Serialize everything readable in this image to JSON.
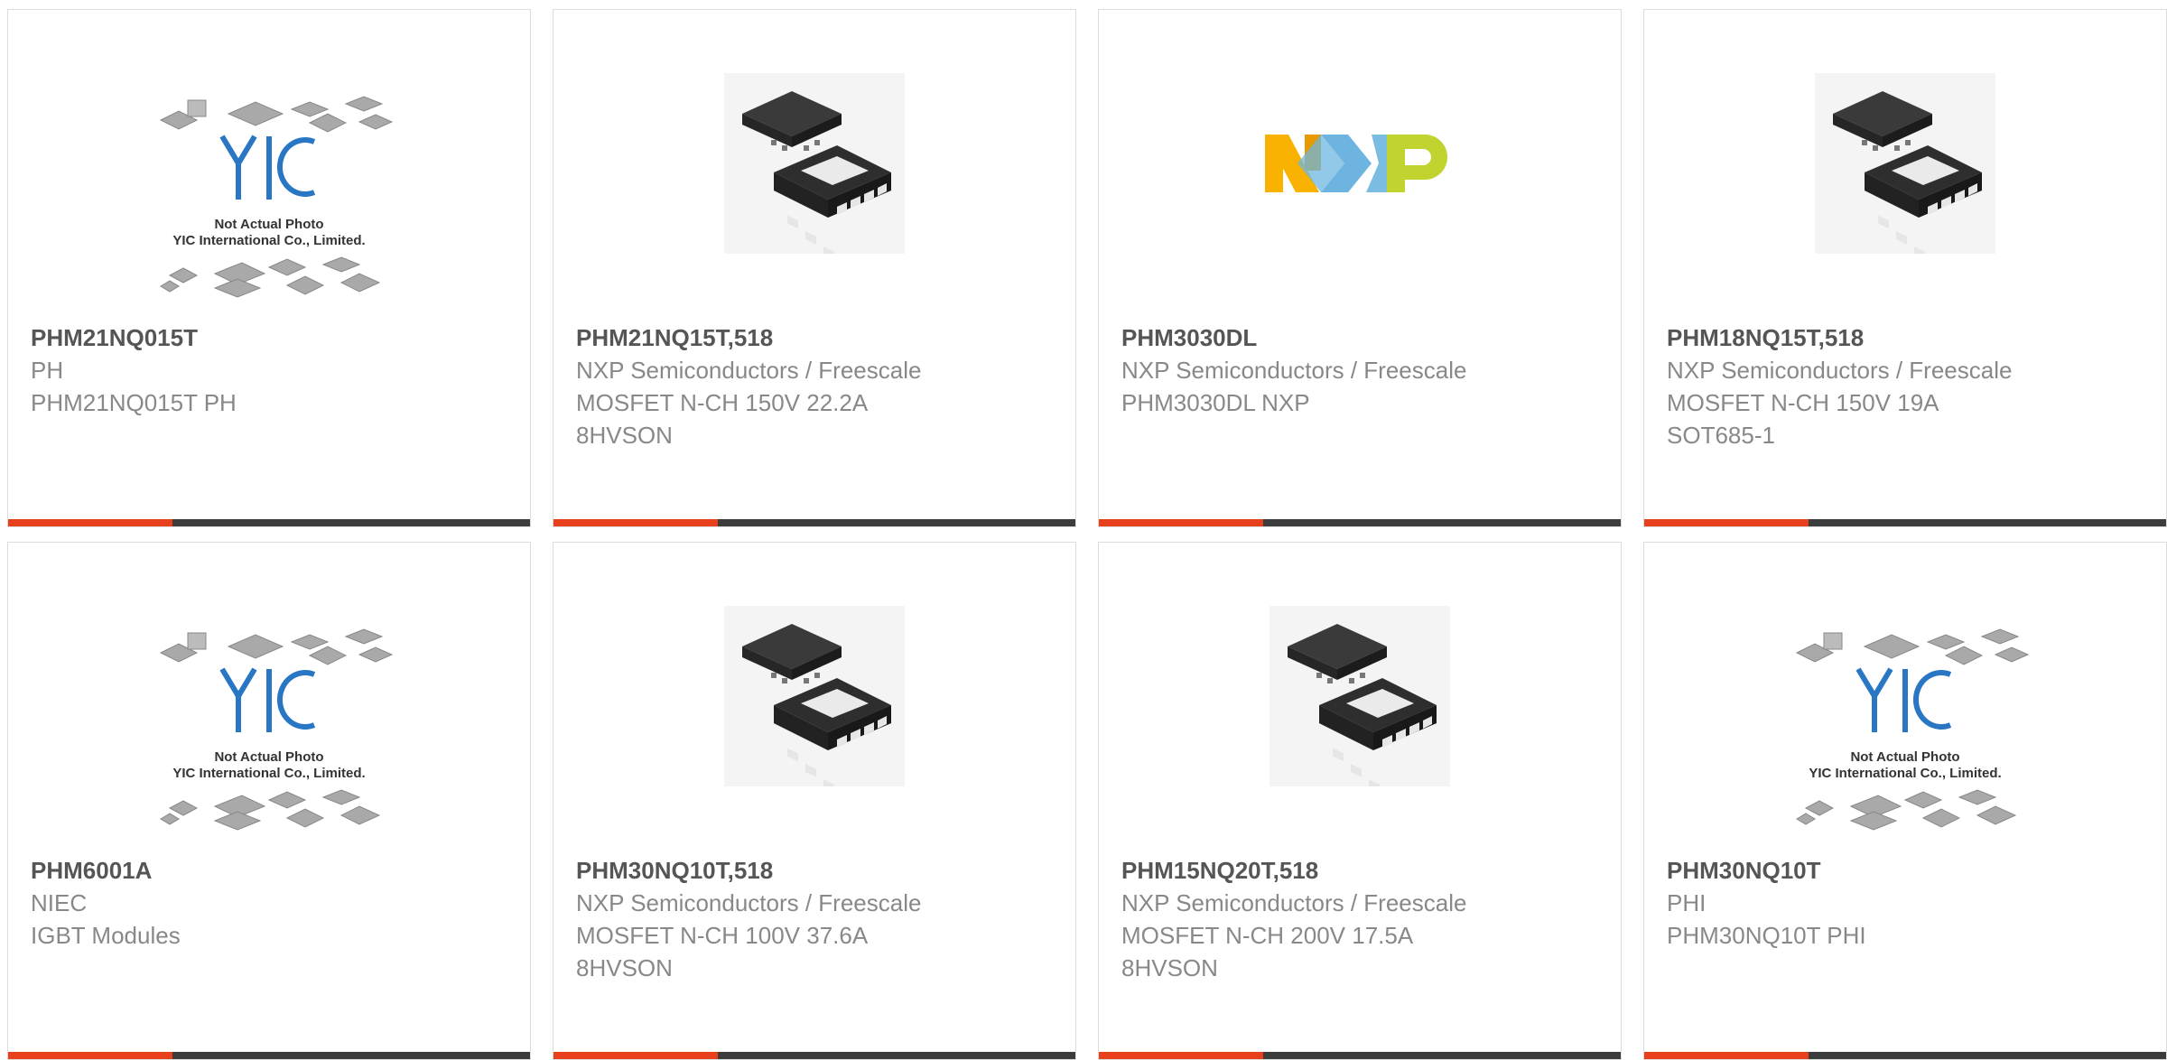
{
  "placeholder": {
    "logo_text": "YIC",
    "caption_line1": "Not Actual Photo",
    "caption_line2": "YIC International Co., Limited."
  },
  "brand_logo": {
    "text": "NXP",
    "colors": [
      "#f9b200",
      "#6db5e0",
      "#c1d32f"
    ]
  },
  "colors": {
    "accent": "#e8401c",
    "bar": "#3c3c3c",
    "title": "#555555",
    "text": "#888888",
    "border": "#dcdcdc"
  },
  "products": [
    {
      "image": "placeholder-photo",
      "part": "PHM21NQ015T",
      "lines": [
        "PH",
        "PHM21NQ015T PH"
      ]
    },
    {
      "image": "chip-8hvson",
      "part": "PHM21NQ15T,518",
      "lines": [
        "NXP Semiconductors / Freescale",
        "MOSFET N-CH 150V 22.2A",
        "8HVSON"
      ]
    },
    {
      "image": "nxp-logo",
      "part": "PHM3030DL",
      "lines": [
        "NXP Semiconductors / Freescale",
        "PHM3030DL NXP"
      ]
    },
    {
      "image": "chip-8hvson",
      "part": "PHM18NQ15T,518",
      "lines": [
        "NXP Semiconductors / Freescale",
        "MOSFET N-CH 150V 19A",
        "SOT685-1"
      ]
    },
    {
      "image": "placeholder-photo",
      "part": "PHM6001A",
      "lines": [
        "NIEC",
        "IGBT Modules"
      ]
    },
    {
      "image": "chip-8hvson",
      "part": "PHM30NQ10T,518",
      "lines": [
        "NXP Semiconductors / Freescale",
        "MOSFET N-CH 100V 37.6A",
        "8HVSON"
      ]
    },
    {
      "image": "chip-8hvson",
      "part": "PHM15NQ20T,518",
      "lines": [
        "NXP Semiconductors / Freescale",
        "MOSFET N-CH 200V 17.5A",
        "8HVSON"
      ]
    },
    {
      "image": "placeholder-photo",
      "part": "PHM30NQ10T",
      "lines": [
        "PHI",
        "PHM30NQ10T PHI"
      ]
    }
  ]
}
